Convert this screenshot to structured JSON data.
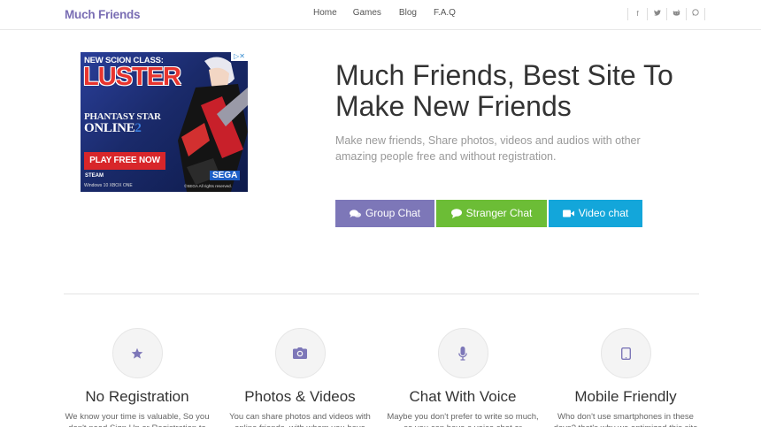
{
  "header": {
    "logo": "Much Friends",
    "nav": [
      "Home",
      "Games",
      "Blog",
      "F.A.Q"
    ],
    "social": [
      "facebook-icon",
      "twitter-icon",
      "reddit-icon",
      "whatsapp-icon"
    ]
  },
  "ad": {
    "headline_small": "NEW SCION CLASS:",
    "headline_big": "LUSTER",
    "game_line1": "PHANTASY STAR",
    "game_line2": "ONLINE",
    "game_num": "2",
    "play_label": "PLAY FREE NOW",
    "steam": "STEAM",
    "platforms": "Windows 10   XBOX ONE",
    "sega": "SEGA",
    "copyright": "©SEGA All rights reserved."
  },
  "hero": {
    "title": "Much Friends, Best Site To Make New Friends",
    "subtitle": "Make new friends, Share photos, videos and audios with other amazing people free and without registration.",
    "buttons": [
      {
        "label": "Group Chat",
        "icon": "comments-icon",
        "color": "#7d77b8"
      },
      {
        "label": "Stranger Chat",
        "icon": "comment-icon",
        "color": "#6cbd36"
      },
      {
        "label": "Video chat",
        "icon": "video-camera-icon",
        "color": "#13a6da"
      }
    ]
  },
  "features": [
    {
      "title": "No Registration",
      "icon": "star-icon",
      "desc": "We know your time is valuable, So you don't need Sign Up or Registration to"
    },
    {
      "title": "Photos & Videos",
      "icon": "camera-icon",
      "desc": "You can share photos and videos with online friends, with whom you have"
    },
    {
      "title": "Chat With Voice",
      "icon": "microphone-icon",
      "desc": "Maybe you don't prefer to write so much, so you can have a voice chat or"
    },
    {
      "title": "Mobile Friendly",
      "icon": "tablet-icon",
      "desc": "Who don't use smartphones in these days? that's why we optimized this site"
    }
  ],
  "colors": {
    "brand": "#7a6eb4",
    "group": "#7d77b8",
    "stranger": "#6cbd36",
    "video": "#13a6da",
    "icon": "#7d77b8"
  }
}
